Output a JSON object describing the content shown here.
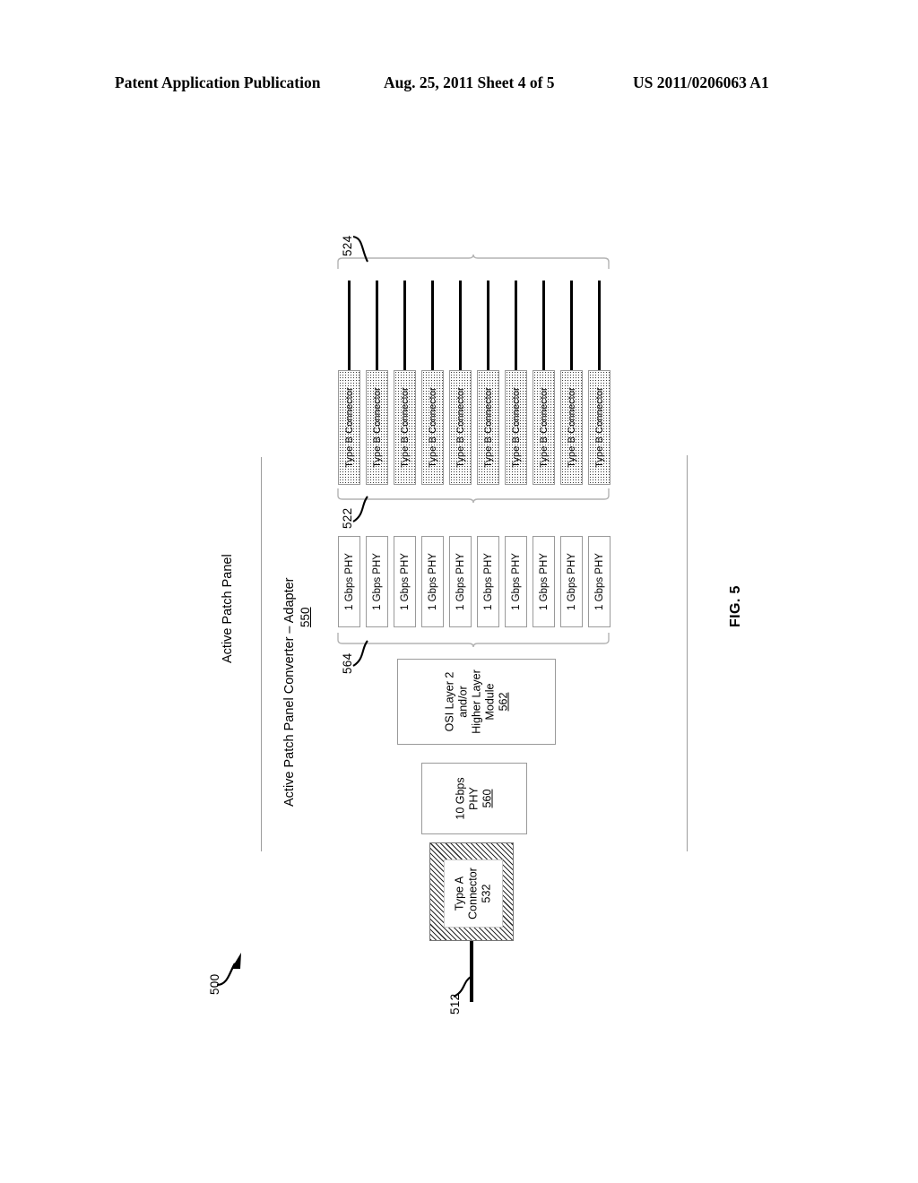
{
  "header": {
    "publication": "Patent Application Publication",
    "date_sheet": "Aug. 25, 2011  Sheet 4 of 5",
    "doc_number": "US 2011/0206063 A1"
  },
  "figure": {
    "caption": "FIG. 5",
    "overall_numeral": "500"
  },
  "regions": {
    "patch_panel_label": "Active Patch Panel",
    "converter_label": "Active Patch Panel Converter – Adapter",
    "converter_numeral": "550"
  },
  "brackets": [
    {
      "numeral": "524",
      "name": "cable-bundle-bracket"
    },
    {
      "numeral": "522",
      "name": "type-b-connector-bracket"
    },
    {
      "numeral": "564",
      "name": "gbps-phy-bracket"
    }
  ],
  "type_b_connectors": [
    {
      "label": "Type B Connector"
    },
    {
      "label": "Type B Connector"
    },
    {
      "label": "Type B Connector"
    },
    {
      "label": "Type B Connector"
    },
    {
      "label": "Type B Connector"
    },
    {
      "label": "Type B Connector"
    },
    {
      "label": "Type B Connector"
    },
    {
      "label": "Type B Connector"
    },
    {
      "label": "Type B Connector"
    },
    {
      "label": "Type B Connector"
    }
  ],
  "gbps_phys": [
    {
      "label": "1 Gbps PHY"
    },
    {
      "label": "1 Gbps PHY"
    },
    {
      "label": "1 Gbps PHY"
    },
    {
      "label": "1 Gbps PHY"
    },
    {
      "label": "1 Gbps PHY"
    },
    {
      "label": "1 Gbps PHY"
    },
    {
      "label": "1 Gbps PHY"
    },
    {
      "label": "1 Gbps PHY"
    },
    {
      "label": "1 Gbps PHY"
    },
    {
      "label": "1 Gbps PHY"
    }
  ],
  "osi_module": {
    "line1": "OSI Layer 2",
    "line2": "and/or",
    "line3": "Higher Layer",
    "line4": "Module",
    "numeral": "562"
  },
  "ten_gbps_phy": {
    "line1": "10 Gbps",
    "line2": "PHY",
    "numeral": "560"
  },
  "type_a_connector": {
    "line1": "Type A",
    "line2": "Connector",
    "numeral": "532"
  },
  "uplink_cable": {
    "numeral": "512"
  },
  "colors": {
    "ink": "#000000",
    "box_border": "#9a9a9a",
    "rule": "#9d9d9d"
  }
}
